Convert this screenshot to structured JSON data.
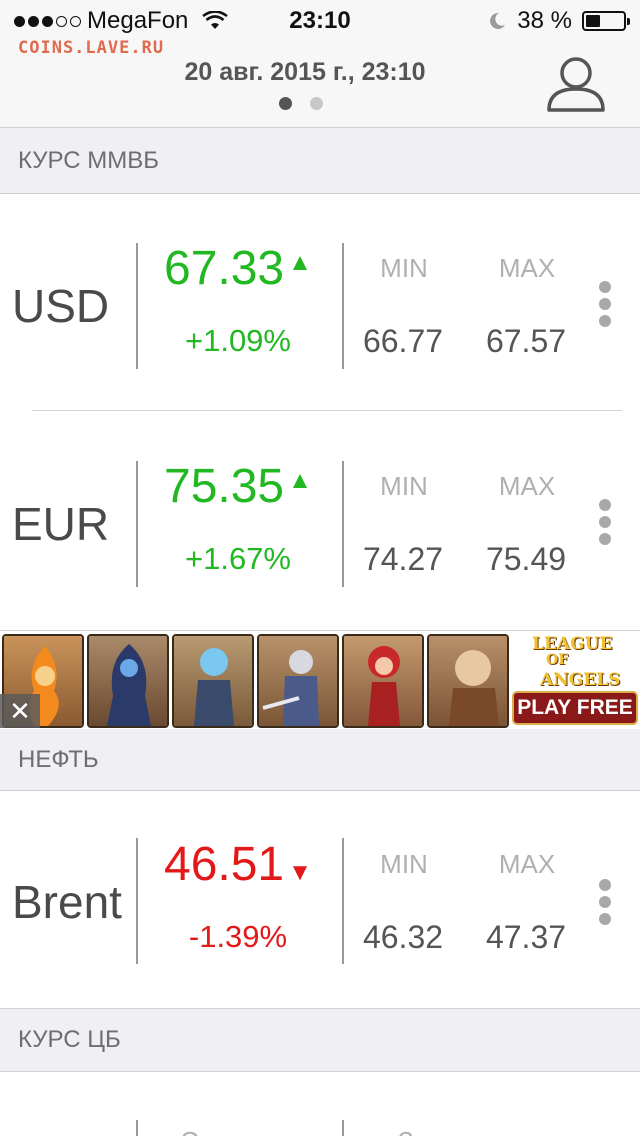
{
  "status_bar": {
    "carrier": "MegaFon",
    "time": "23:10",
    "battery": "38 %",
    "signal_bars_filled": 3,
    "signal_bars_total": 5
  },
  "header": {
    "watermark": "COINS.LAVE.RU",
    "datetime": "20 авг. 2015 г., 23:10",
    "page_count": 2,
    "active_page": 1
  },
  "sections": {
    "mmvb": "КУРС ММВБ",
    "oil": "НЕФТЬ",
    "cb": "КУРС ЦБ"
  },
  "labels": {
    "min": "MIN",
    "max": "MAX"
  },
  "rates": [
    {
      "code": "USD",
      "value": "67.33",
      "trend": "up",
      "arrow": "▲",
      "change": "+1.09%",
      "min": "66.77",
      "max": "67.57"
    },
    {
      "code": "EUR",
      "value": "75.35",
      "trend": "up",
      "arrow": "▲",
      "change": "+1.67%",
      "min": "74.27",
      "max": "75.49"
    }
  ],
  "oil": [
    {
      "code": "Brent",
      "value": "46.51",
      "trend": "down",
      "arrow": "▼",
      "change": "-1.39%",
      "min": "46.32",
      "max": "47.37"
    }
  ],
  "cb_partial": {
    "today_label": "Сегодня",
    "tomorrow_label": "Завтра"
  },
  "ad": {
    "close": "✕",
    "logo_line1": "LEAGUE",
    "logo_line2": "OF",
    "logo_line3": "ANGELS",
    "cta": "PLAY FREE"
  },
  "colors": {
    "up": "#21b821",
    "down": "#e31919",
    "section_bg": "#efeff4",
    "header_bg": "#f7f7f7"
  }
}
